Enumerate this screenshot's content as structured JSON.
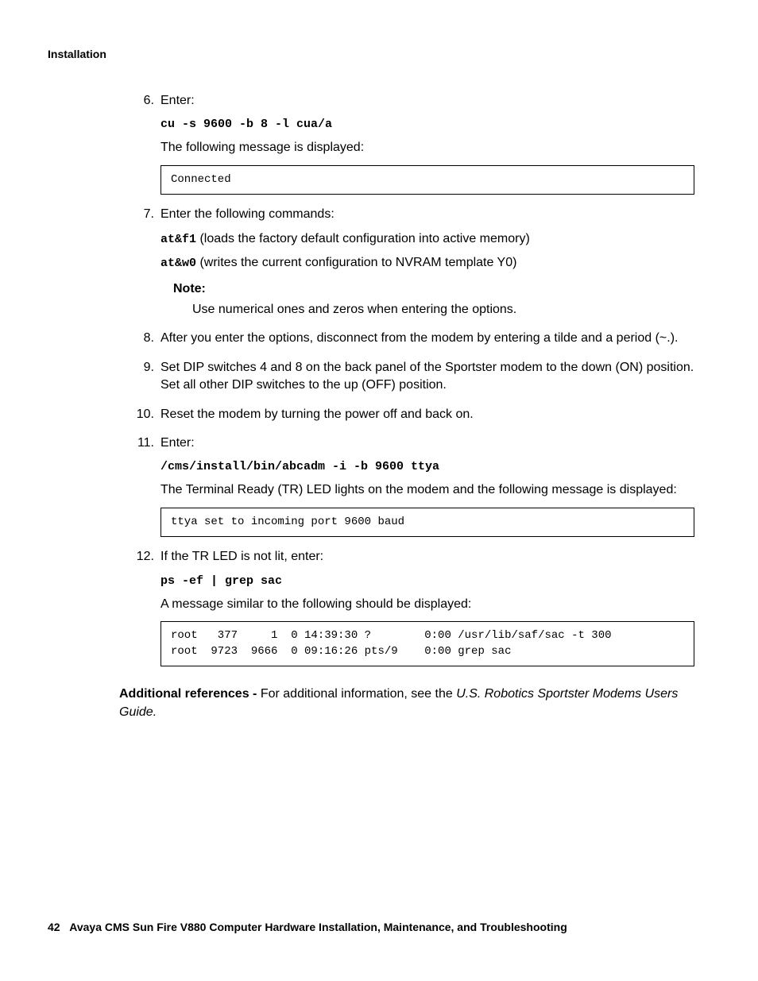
{
  "header": "Installation",
  "steps": {
    "s6": {
      "num": "6.",
      "label": "Enter:",
      "cmd": "cu -s 9600 -b 8 -l cua/a",
      "msg": "The following message is displayed:",
      "output": "Connected"
    },
    "s7": {
      "num": "7.",
      "label": "Enter the following commands:",
      "cmd1": "at&f1",
      "desc1": " (loads the factory default configuration into active memory)",
      "cmd2": "at&w0",
      "desc2": " (writes the current configuration to NVRAM template Y0)",
      "noteLabel": "Note:",
      "noteText": "Use numerical ones and zeros when entering the options."
    },
    "s8": {
      "num": "8.",
      "text": "After you enter the options, disconnect from the modem by entering a tilde and a period (~.)."
    },
    "s9": {
      "num": "9.",
      "text": "Set DIP switches 4 and 8 on the back panel of the Sportster modem to the down (ON) position. Set all other DIP switches to the up (OFF) position."
    },
    "s10": {
      "num": "10.",
      "text": "Reset the modem by turning the power off and back on."
    },
    "s11": {
      "num": "11.",
      "label": "Enter:",
      "cmd": "/cms/install/bin/abcadm -i -b 9600 ttya",
      "msg": "The Terminal Ready (TR) LED lights on the modem and the following message is displayed:",
      "output": "ttya set to incoming port 9600 baud"
    },
    "s12": {
      "num": "12.",
      "label": "If the TR LED is not lit, enter:",
      "cmd": "ps -ef | grep sac",
      "msg": "A message similar to the following should be displayed:",
      "output": "root   377     1  0 14:39:30 ?        0:00 /usr/lib/saf/sac -t 300\nroot  9723  9666  0 09:16:26 pts/9    0:00 grep sac"
    }
  },
  "additional": {
    "prefix": "Additional references - ",
    "text1": "For additional information, see the ",
    "italic": "U.S. Robotics Sportster Modems Users Guide."
  },
  "footer": {
    "pageNum": "42",
    "title": "Avaya CMS Sun Fire V880 Computer Hardware Installation, Maintenance, and Troubleshooting"
  }
}
